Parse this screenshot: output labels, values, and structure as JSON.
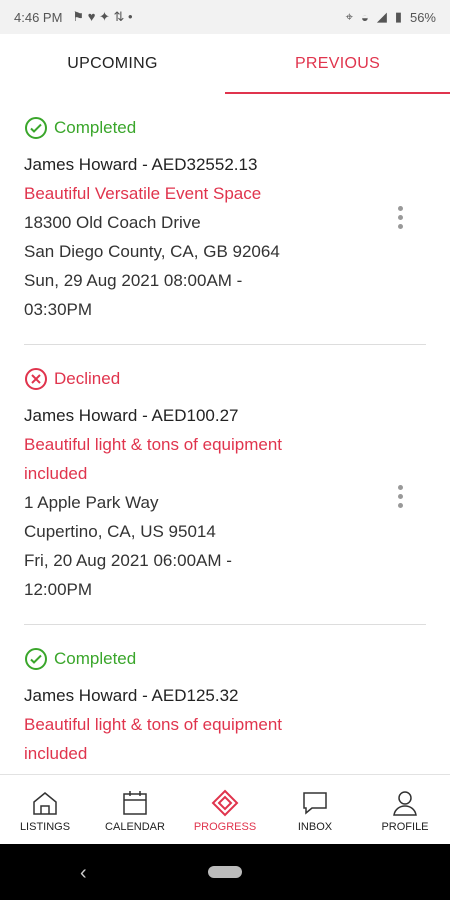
{
  "status_bar": {
    "time": "4:46 PM",
    "battery": "56%"
  },
  "tabs": [
    {
      "label": "UPCOMING",
      "active": false
    },
    {
      "label": "PREVIOUS",
      "active": true
    }
  ],
  "bookings": [
    {
      "status": "Completed",
      "guest": "James Howard - AED32552.13",
      "venue": "Beautiful Versatile Event Space",
      "address1": "18300 Old Coach Drive",
      "address2": "San Diego County, CA, GB 92064",
      "date_line1": "Sun, 29 Aug 2021 08:00AM -",
      "date_line2": "03:30PM"
    },
    {
      "status": "Declined",
      "guest": "James Howard - AED100.27",
      "venue_line1": "Beautiful light & tons of equipment",
      "venue_line2": "included",
      "address1": "1 Apple Park Way",
      "address2": "Cupertino, CA, US 95014",
      "date_line1": "Fri, 20 Aug 2021 06:00AM -",
      "date_line2": "12:00PM"
    },
    {
      "status": "Completed",
      "guest": "James Howard - AED125.32",
      "venue_line1": "Beautiful light & tons of equipment",
      "venue_line2": "included"
    }
  ],
  "bottom_nav": [
    {
      "label": "LISTINGS",
      "icon": "house-icon",
      "active": false
    },
    {
      "label": "CALENDAR",
      "icon": "calendar-icon",
      "active": false
    },
    {
      "label": "PROGRESS",
      "icon": "progress-logo-icon",
      "active": true
    },
    {
      "label": "INBOX",
      "icon": "chat-icon",
      "active": false
    },
    {
      "label": "PROFILE",
      "icon": "person-icon",
      "active": false
    }
  ],
  "colors": {
    "accent": "#e0344d",
    "completed": "#3aa62b"
  }
}
